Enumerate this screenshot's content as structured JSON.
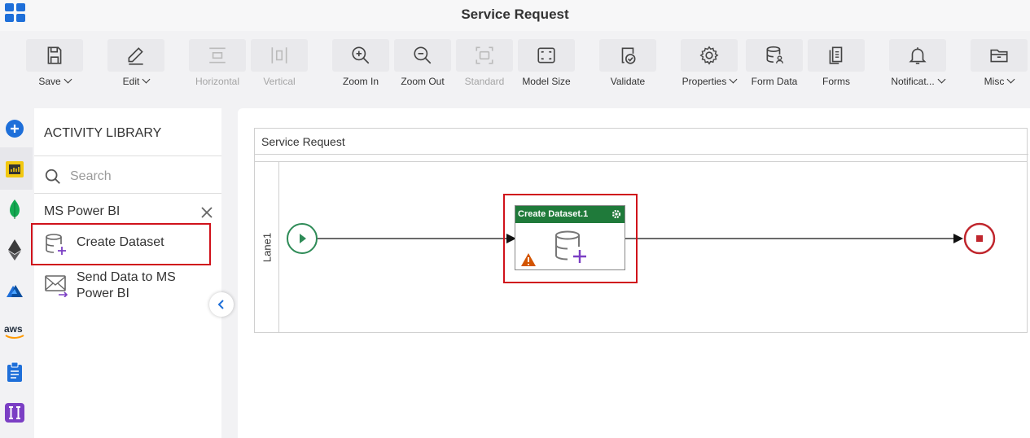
{
  "header": {
    "title": "Service Request"
  },
  "toolbar": {
    "save": "Save",
    "edit": "Edit",
    "horizontal": "Horizontal",
    "vertical": "Vertical",
    "zoom_in": "Zoom In",
    "zoom_out": "Zoom Out",
    "standard": "Standard",
    "model_size": "Model Size",
    "validate": "Validate",
    "properties": "Properties",
    "form_data": "Form Data",
    "forms": "Forms",
    "notifications": "Notificat...",
    "misc": "Misc"
  },
  "rail": {
    "icons": [
      "add-icon",
      "power-bi-icon",
      "mongodb-icon",
      "ethereum-icon",
      "azure-icon",
      "aws-icon",
      "clipboard-icon",
      "integration-icon"
    ],
    "aws_text": "aws"
  },
  "library": {
    "title": "ACTIVITY LIBRARY",
    "search_placeholder": "Search",
    "category": "MS Power BI",
    "items": [
      {
        "label": "Create Dataset"
      },
      {
        "label": "Send Data to MS Power BI"
      }
    ]
  },
  "canvas": {
    "pool_title": "Service Request",
    "lane_label": "Lane1",
    "task_title": "Create Dataset.1"
  },
  "colors": {
    "accent": "#1e6fd9",
    "task_header": "#1f7a3a",
    "start_event": "#2e8b57",
    "end_event": "#c0262d",
    "highlight": "#d0121b",
    "warning": "#d35400"
  }
}
